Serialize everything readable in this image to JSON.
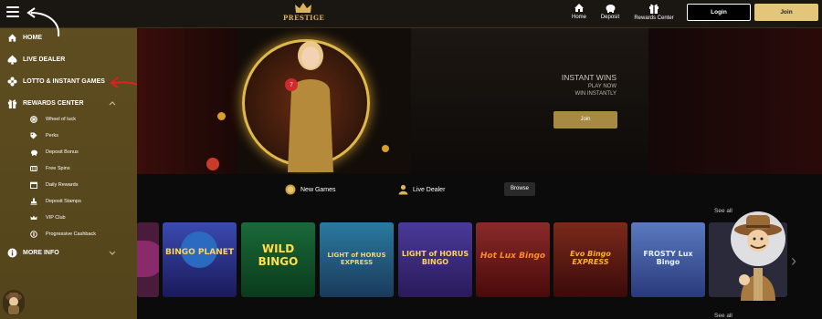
{
  "header": {
    "logo_text": "PRESTIGE",
    "nav": [
      {
        "label": "Home",
        "icon": "home-icon"
      },
      {
        "label": "Deposit",
        "icon": "piggy-bank-icon"
      },
      {
        "label": "Rewards Center",
        "icon": "gift-icon"
      }
    ],
    "login_label": "Login",
    "join_label": "Join"
  },
  "sidebar": {
    "items": [
      {
        "label": "HOME",
        "icon": "home-icon"
      },
      {
        "label": "LIVE DEALER",
        "icon": "spade-icon"
      },
      {
        "label": "LOTTO & INSTANT GAMES",
        "icon": "clover-icon"
      },
      {
        "label": "REWARDS CENTER",
        "icon": "gift-icon",
        "expanded": true
      }
    ],
    "rewards_sub": [
      {
        "label": "Wheel of luck",
        "icon": "wheel-icon"
      },
      {
        "label": "Perks",
        "icon": "tag-icon"
      },
      {
        "label": "Deposit Bonus",
        "icon": "piggy-bank-icon"
      },
      {
        "label": "Free Spins",
        "icon": "spins-icon"
      },
      {
        "label": "Daily Rewards",
        "icon": "calendar-icon"
      },
      {
        "label": "Deposit Stamps",
        "icon": "stamp-icon"
      },
      {
        "label": "VIP Club",
        "icon": "crown-icon"
      },
      {
        "label": "Progressive Cashback",
        "icon": "cashback-icon"
      }
    ],
    "more_info": {
      "label": "MORE INFO",
      "icon": "info-icon"
    }
  },
  "hero": {
    "title": "INSTANT WINS",
    "line1": "PLAY NOW",
    "line2": "WIN INSTANTLY",
    "join_label": "Join"
  },
  "tabs": [
    {
      "label": "New Games",
      "icon": "coin-icon"
    },
    {
      "label": "Live Dealer",
      "icon": "dealer-icon"
    },
    {
      "label": "Browse"
    }
  ],
  "see_all_1": "See all",
  "see_all_2": "See all",
  "games": [
    {
      "title": "",
      "bg": "#4a1c3c"
    },
    {
      "title": "BINGO PLANET",
      "bg": "#2b3a8a"
    },
    {
      "title": "WILD BINGO",
      "bg": "#0f4a2a"
    },
    {
      "title": "LIGHT of HORUS EXPRESS",
      "bg": "#1a5a7a"
    },
    {
      "title": "LIGHT of HORUS BINGO",
      "bg": "#3a2a6a"
    },
    {
      "title": "Hot Lux Bingo",
      "bg": "#6a1a1a"
    },
    {
      "title": "Evo Bingo EXPRESS",
      "bg": "#6a2a1a"
    },
    {
      "title": "FROSTY Lux Bingo",
      "bg": "#3a5a9a"
    },
    {
      "title": "",
      "bg": "#2a2a3a"
    }
  ],
  "colors": {
    "gold": "#d9b45a",
    "sidebar": "#5a4a1f",
    "join": "#e3c67a",
    "annotation_red": "#e02020"
  }
}
